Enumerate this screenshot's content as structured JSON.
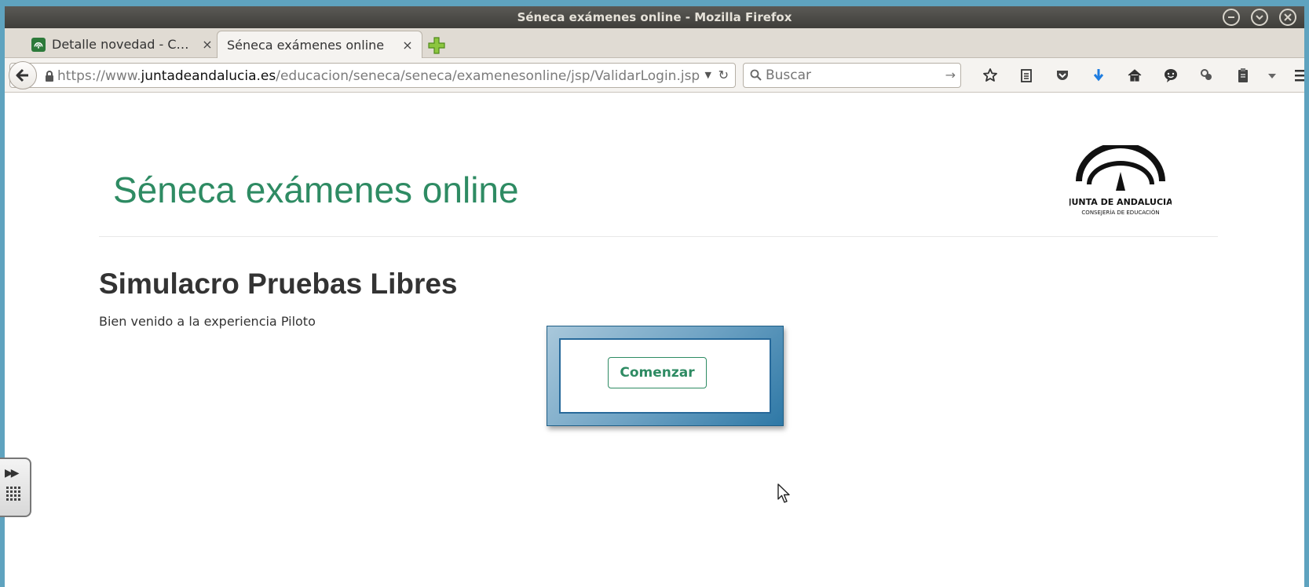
{
  "window": {
    "title": "Séneca exámenes online - Mozilla Firefox"
  },
  "tabs": [
    {
      "label": "Detalle novedad - C…",
      "close": "×",
      "favicon": "junta-favicon-icon"
    },
    {
      "label": "Séneca exámenes online",
      "close": "×",
      "active": true
    }
  ],
  "navbar": {
    "url_prefix": "https://www.",
    "url_host": "juntadeandalucia.es",
    "url_path": "/educacion/seneca/seneca/examenesonline/jsp/ValidarLogin.jsp",
    "search_placeholder": "Buscar"
  },
  "page": {
    "site_title": "Séneca exámenes online",
    "heading": "Simulacro Pruebas Libres",
    "subtext": "Bien venido a la experiencia Piloto",
    "start_button": "Comenzar"
  },
  "logo": {
    "line1": "JUNTA DE ANDALUCIA",
    "line2": "CONSEJERÍA DE EDUCACIÓN"
  },
  "colors": {
    "brand_green": "#2e8b63",
    "dialog_blue": "#2e78a6"
  }
}
